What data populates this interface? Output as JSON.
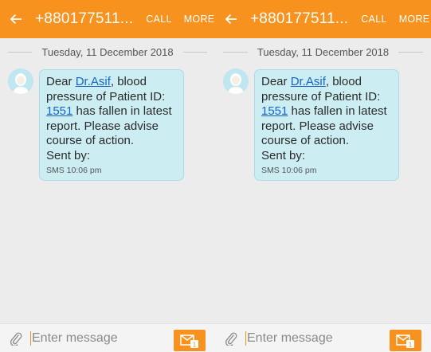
{
  "theme": {
    "accent": "#f7921e",
    "bubble_bg": "#cceef3",
    "link": "#1565c0"
  },
  "screens": [
    {
      "header": {
        "back_icon": "arrow-left-icon",
        "title": "+880177511...",
        "call": "CALL",
        "more": "MORE"
      },
      "date_divider": "Tuesday, 11 December 2018",
      "message": {
        "avatar_icon": "contact-avatar",
        "t1": "Dear ",
        "link1": "Dr.Asif",
        "t2": ", blood pressure of Patient ID: ",
        "link2": "1551",
        "t3": " has fallen in latest report. Please advise course of action.",
        "sent_by": "Sent by:",
        "meta": "SMS 10:06 pm"
      },
      "composer": {
        "attach_icon": "paperclip-icon",
        "placeholder": "Enter message",
        "send_icon": "send-sms-icon",
        "send_badge": "1"
      }
    },
    {
      "header": {
        "back_icon": "arrow-left-icon",
        "title": "+880177511...",
        "call": "CALL",
        "more": "MORE"
      },
      "date_divider": "Tuesday, 11 December 2018",
      "message": {
        "avatar_icon": "contact-avatar",
        "t1": "Dear ",
        "link1": "Dr.Asif",
        "t2": ", blood pressure of Patient ID: ",
        "link2": "1551",
        "t3": " has fallen in latest report. Please advise course of action.",
        "sent_by": "Sent by:",
        "meta": "SMS 10:06 pm"
      },
      "composer": {
        "attach_icon": "paperclip-icon",
        "placeholder": "Enter message",
        "send_icon": "send-sms-icon",
        "send_badge": "1"
      }
    }
  ]
}
